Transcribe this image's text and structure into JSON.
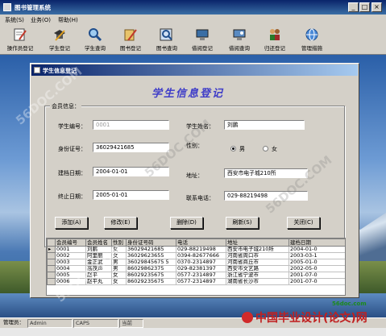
{
  "window": {
    "title": "图书管理系统"
  },
  "menubar": {
    "items": [
      "系统(S)",
      "业务(O)",
      "帮助(H)"
    ]
  },
  "toolbar": {
    "buttons": [
      {
        "label": "操作员登记",
        "icon": "notebook-pencil-icon"
      },
      {
        "label": "学生登记",
        "icon": "pencil-hat-icon"
      },
      {
        "label": "学生查询",
        "icon": "magnifier-icon"
      },
      {
        "label": "图书登记",
        "icon": "book-pencil-icon"
      },
      {
        "label": "图书查询",
        "icon": "book-search-icon"
      },
      {
        "label": "借阅登记",
        "icon": "lending-computer-icon"
      },
      {
        "label": "借阅查询",
        "icon": "lending-search-icon"
      },
      {
        "label": "归还登记",
        "icon": "return-people-icon"
      },
      {
        "label": "管理措施",
        "icon": "globe-icon"
      }
    ]
  },
  "child": {
    "title": "学生信息登记",
    "heading": "学生信息登记",
    "group_label": "会员信息：",
    "labels": {
      "student_no": "学生编号：",
      "id_card": "身份证号：",
      "created_date": "建档日期：",
      "end_date": "终止日期：",
      "student_name": "学生姓名：",
      "gender": "性别：",
      "male": "男",
      "female": "女",
      "address": "地址：",
      "phone": "联系电话："
    },
    "values": {
      "student_no": "0001",
      "id_card": "36029421685",
      "created_date": "2004-01-01",
      "end_date": "2005-01-01",
      "student_name": "刘鹏",
      "gender": "男",
      "address": "西安市电子城210所",
      "phone": "029-88219498"
    },
    "buttons": {
      "add": "添加(A)",
      "edit": "修改(E)",
      "delete": "删除(D)",
      "refresh": "刷新(S)",
      "close": "关闭(C)"
    },
    "grid": {
      "columns": [
        "会员编号",
        "会员姓名",
        "性别",
        "身份证号码",
        "电话",
        "地址",
        "建档日期"
      ],
      "rows": [
        [
          "0001",
          "刘鹏",
          "女",
          "36029421685",
          "029-88219498",
          "西安市电子城210所",
          "2004-01-0"
        ],
        [
          "0002",
          "阿里丽",
          "女",
          "36029623655",
          "0394-82677666",
          "河南省周口市",
          "2003-03-1"
        ],
        [
          "0003",
          "金正武",
          "男",
          "36029845675 5",
          "0370-2314897",
          "河南省商丘市",
          "2005-01-0"
        ],
        [
          "0004",
          "高茂声",
          "男",
          "86029862375",
          "029-82381397",
          "西安市文艺路",
          "2002-05-0"
        ],
        [
          "0005",
          "赵平",
          "女",
          "86029235675",
          "0577-2314897",
          "浙江省宁波市",
          "2001-07-0"
        ],
        [
          "0006",
          "赵平丸",
          "女",
          "86029235675",
          "0577-2314897",
          "湖南省长沙市",
          "2001-07-0"
        ]
      ]
    }
  },
  "statusbar": {
    "operator": "管理员：",
    "user": "Admin",
    "caps": "CAPS",
    "extra": "当前"
  },
  "watermarks": {
    "text": "56DOC.COM",
    "site": "56doc.com",
    "brand": "中国毕业设计(论文)网"
  }
}
